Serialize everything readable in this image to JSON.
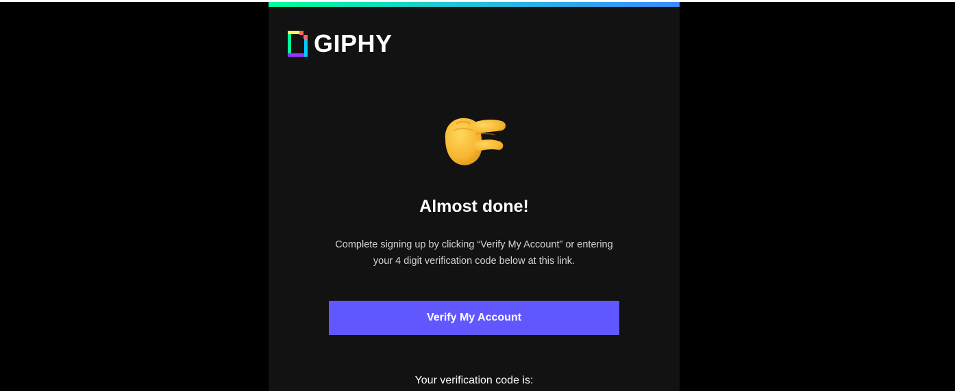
{
  "brand": {
    "name": "GIPHY",
    "accent_gradient": [
      "#00ff99",
      "#1fc7d4",
      "#3a8cff"
    ]
  },
  "hero": {
    "icon": "pinching-hand-icon"
  },
  "content": {
    "title": "Almost done!",
    "description": "Complete signing up by clicking “Verify My Account” or entering your 4 digit verification code below at this link.",
    "verify_button_label": "Verify My Account",
    "button_color": "#6157ff",
    "code_label": "Your verification code is:"
  }
}
